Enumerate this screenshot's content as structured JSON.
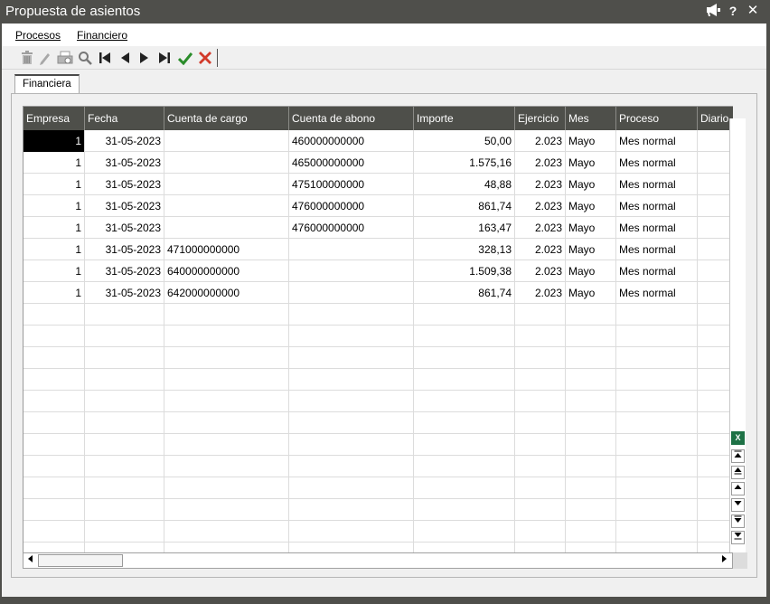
{
  "window": {
    "title": "Propuesta de asientos"
  },
  "titlebar_icons": [
    "megaphone-icon",
    "help-icon",
    "close-icon"
  ],
  "titlebar_help": "?",
  "titlebar_close": "✕",
  "menu": [
    {
      "label": "Procesos"
    },
    {
      "label": "Financiero"
    }
  ],
  "toolbar_icons": [
    "delete-icon",
    "edit-icon",
    "print-preview-icon",
    "search-icon",
    "first-record-icon",
    "previous-record-icon",
    "next-record-icon",
    "last-record-icon",
    "accept-icon",
    "cancel-icon"
  ],
  "tabs": [
    {
      "label": "Financiera"
    }
  ],
  "grid": {
    "columns": [
      "Empresa",
      "Fecha",
      "Cuenta de cargo",
      "Cuenta de abono",
      "Importe",
      "Ejercicio",
      "Mes",
      "Proceso",
      "Diario"
    ],
    "rows": [
      {
        "empresa": "1",
        "fecha": "31-05-2023",
        "cargo": "",
        "abono": "460000000000",
        "importe": "50,00",
        "ejercicio": "2.023",
        "mes": "Mayo",
        "proceso": "Mes normal",
        "diario": ""
      },
      {
        "empresa": "1",
        "fecha": "31-05-2023",
        "cargo": "",
        "abono": "465000000000",
        "importe": "1.575,16",
        "ejercicio": "2.023",
        "mes": "Mayo",
        "proceso": "Mes normal",
        "diario": ""
      },
      {
        "empresa": "1",
        "fecha": "31-05-2023",
        "cargo": "",
        "abono": "475100000000",
        "importe": "48,88",
        "ejercicio": "2.023",
        "mes": "Mayo",
        "proceso": "Mes normal",
        "diario": ""
      },
      {
        "empresa": "1",
        "fecha": "31-05-2023",
        "cargo": "",
        "abono": "476000000000",
        "importe": "861,74",
        "ejercicio": "2.023",
        "mes": "Mayo",
        "proceso": "Mes normal",
        "diario": ""
      },
      {
        "empresa": "1",
        "fecha": "31-05-2023",
        "cargo": "",
        "abono": "476000000000",
        "importe": "163,47",
        "ejercicio": "2.023",
        "mes": "Mayo",
        "proceso": "Mes normal",
        "diario": ""
      },
      {
        "empresa": "1",
        "fecha": "31-05-2023",
        "cargo": "471000000000",
        "abono": "",
        "importe": "328,13",
        "ejercicio": "2.023",
        "mes": "Mayo",
        "proceso": "Mes normal",
        "diario": ""
      },
      {
        "empresa": "1",
        "fecha": "31-05-2023",
        "cargo": "640000000000",
        "abono": "",
        "importe": "1.509,38",
        "ejercicio": "2.023",
        "mes": "Mayo",
        "proceso": "Mes normal",
        "diario": ""
      },
      {
        "empresa": "1",
        "fecha": "31-05-2023",
        "cargo": "642000000000",
        "abono": "",
        "importe": "861,74",
        "ejercicio": "2.023",
        "mes": "Mayo",
        "proceso": "Mes normal",
        "diario": ""
      }
    ],
    "empty_rows": 12
  },
  "side_icons": [
    "excel-export-icon",
    "scroll-top-icon",
    "scroll-page-up-icon",
    "scroll-up-icon",
    "scroll-down-icon",
    "scroll-page-down-icon",
    "scroll-bottom-icon"
  ],
  "excel_glyph": "X",
  "colors": {
    "titlebar": "#4f4f4b",
    "header": "#4e4f4a",
    "accept": "#2a8c2a",
    "cancel": "#d23a2a",
    "excel": "#1d7145"
  }
}
